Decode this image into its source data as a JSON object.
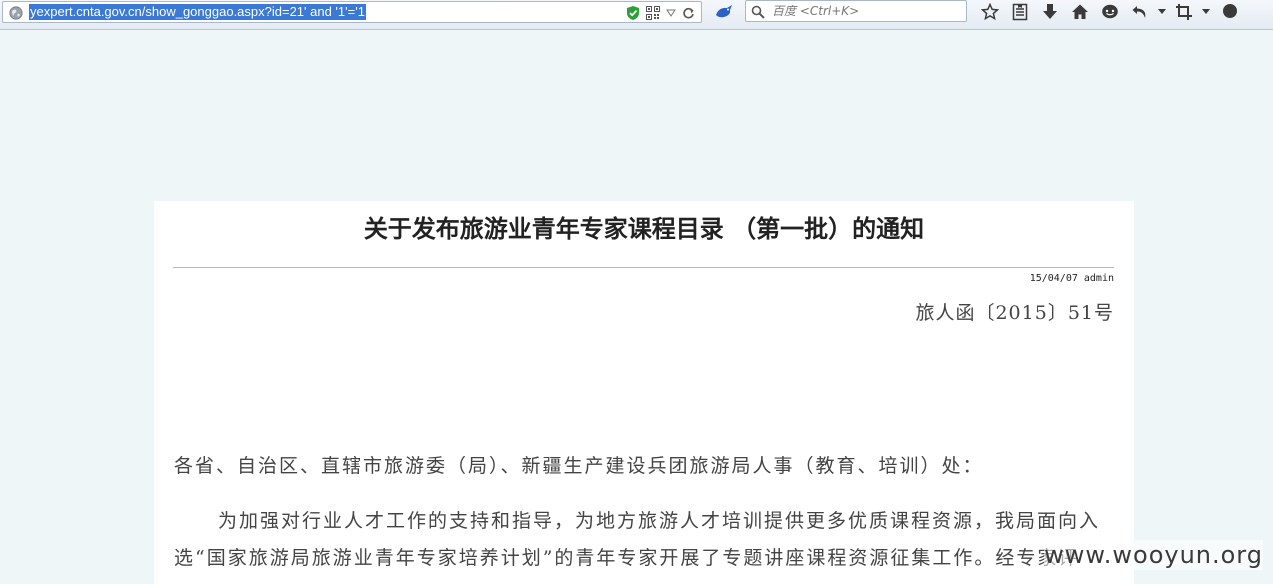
{
  "browser": {
    "url": "yexpert.cnta.gov.cn/show_gonggao.aspx?id=21' and '1'='1",
    "search_placeholder": "百度 <Ctrl+K>",
    "url_icons": [
      "shield-check-icon",
      "qr-code-icon",
      "dropdown-arrow-icon",
      "reload-icon"
    ],
    "toolbar_icons": [
      "bookmark-star-icon",
      "reading-list-icon",
      "download-icon",
      "home-icon",
      "chat-icon",
      "undo-icon",
      "crop-icon",
      "more-icon"
    ]
  },
  "document": {
    "title": "关于发布旅游业青年专家课程目录 （第一批）的通知",
    "meta": "15/04/07 admin",
    "doc_number": "旅人函〔2015〕51号",
    "salutation": "各省、自治区、直辖市旅游委（局）、新疆生产建设兵团旅游局人事（教育、培训）处：",
    "paragraph_line1": "为加强对行业人才工作的支持和指导，为地方旅游人才培训提供更多优质课程资源，我局面向入",
    "paragraph_line2": "选“国家旅游局旅游业青年专家培养计划”的青年专家开展了专题讲座课程资源征集工作。经专家评"
  },
  "watermark": "www.wooyun.org",
  "colors": {
    "page_background": "#eef6f8",
    "url_selection": "#3b79d6",
    "shield_green": "#2e9e3a"
  }
}
